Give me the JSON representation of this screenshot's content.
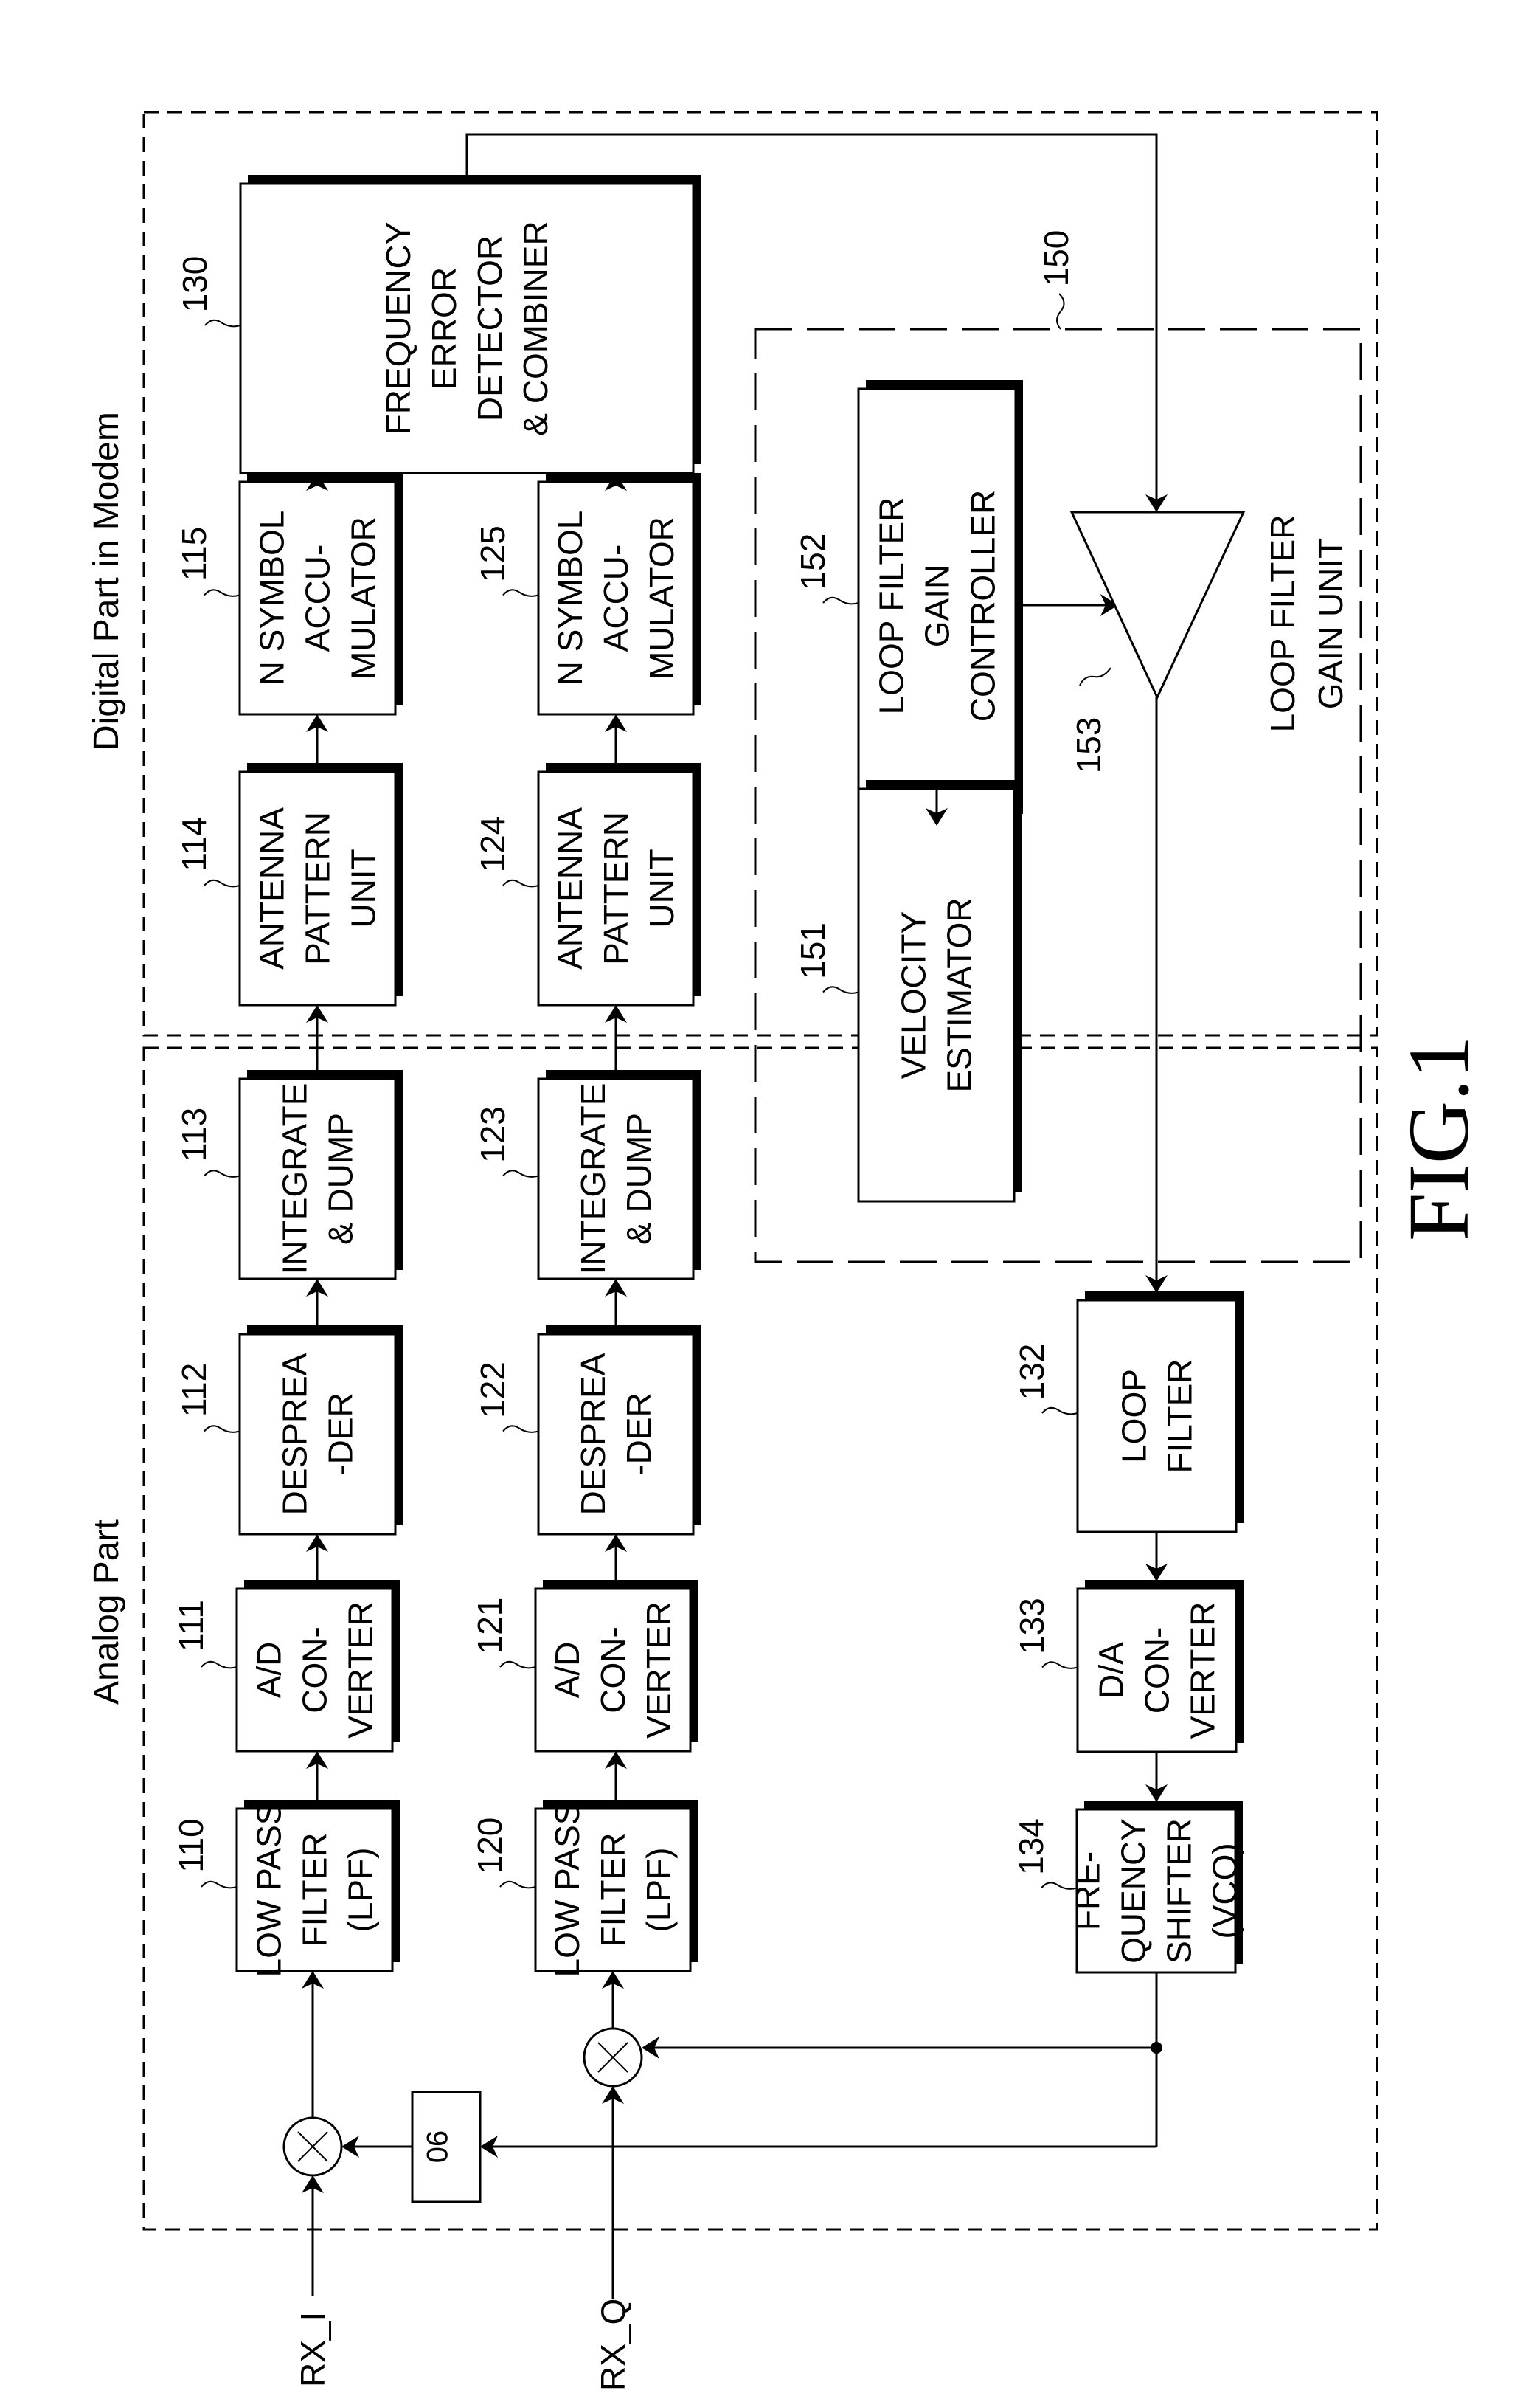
{
  "figure": {
    "caption": "FIG.1",
    "regions": {
      "digital": "Digital Part in Modem",
      "analog": "Analog Part",
      "gain_unit_ref": "150",
      "gain_unit_label": [
        "LOOP FILTER",
        "GAIN UNIT"
      ]
    },
    "inputs": {
      "rx_i": "RX_I",
      "rx_q": "RX_Q"
    },
    "phase_shift": "90",
    "amplifier_ref": "153",
    "blocks": [
      {
        "id": "130",
        "lines": [
          "FREQUENCY",
          "ERROR",
          "DETECTOR",
          "& COMBINER"
        ]
      },
      {
        "id": "115",
        "lines": [
          "N SYMBOL",
          "ACCU-",
          "MULATOR"
        ]
      },
      {
        "id": "125",
        "lines": [
          "N SYMBOL",
          "ACCU-",
          "MULATOR"
        ]
      },
      {
        "id": "114",
        "lines": [
          "ANTENNA",
          "PATTERN",
          "UNIT"
        ]
      },
      {
        "id": "124",
        "lines": [
          "ANTENNA",
          "PATTERN",
          "UNIT"
        ]
      },
      {
        "id": "113",
        "lines": [
          "INTEGRATE",
          "& DUMP"
        ]
      },
      {
        "id": "123",
        "lines": [
          "INTEGRATE",
          "& DUMP"
        ]
      },
      {
        "id": "112",
        "lines": [
          "DESPREA",
          "-DER"
        ]
      },
      {
        "id": "122",
        "lines": [
          "DESPREA",
          "-DER"
        ]
      },
      {
        "id": "111",
        "lines": [
          "A/D",
          "CON-",
          "VERTER"
        ]
      },
      {
        "id": "121",
        "lines": [
          "A/D",
          "CON-",
          "VERTER"
        ]
      },
      {
        "id": "110",
        "lines": [
          "LOW PASS",
          "FILTER",
          "(LPF)"
        ]
      },
      {
        "id": "120",
        "lines": [
          "LOW PASS",
          "FILTER",
          "(LPF)"
        ]
      },
      {
        "id": "152",
        "lines": [
          "LOOP FILTER",
          "GAIN",
          "CONTROLLER"
        ]
      },
      {
        "id": "151",
        "lines": [
          "VELOCITY",
          "ESTIMATOR"
        ]
      },
      {
        "id": "132",
        "lines": [
          "LOOP",
          "FILTER"
        ]
      },
      {
        "id": "133",
        "lines": [
          "D/A",
          "CON-",
          "VERTER"
        ]
      },
      {
        "id": "134",
        "lines": [
          "FRE-",
          "QUENCY",
          "SHIFTER",
          "(VCO)"
        ]
      }
    ]
  }
}
